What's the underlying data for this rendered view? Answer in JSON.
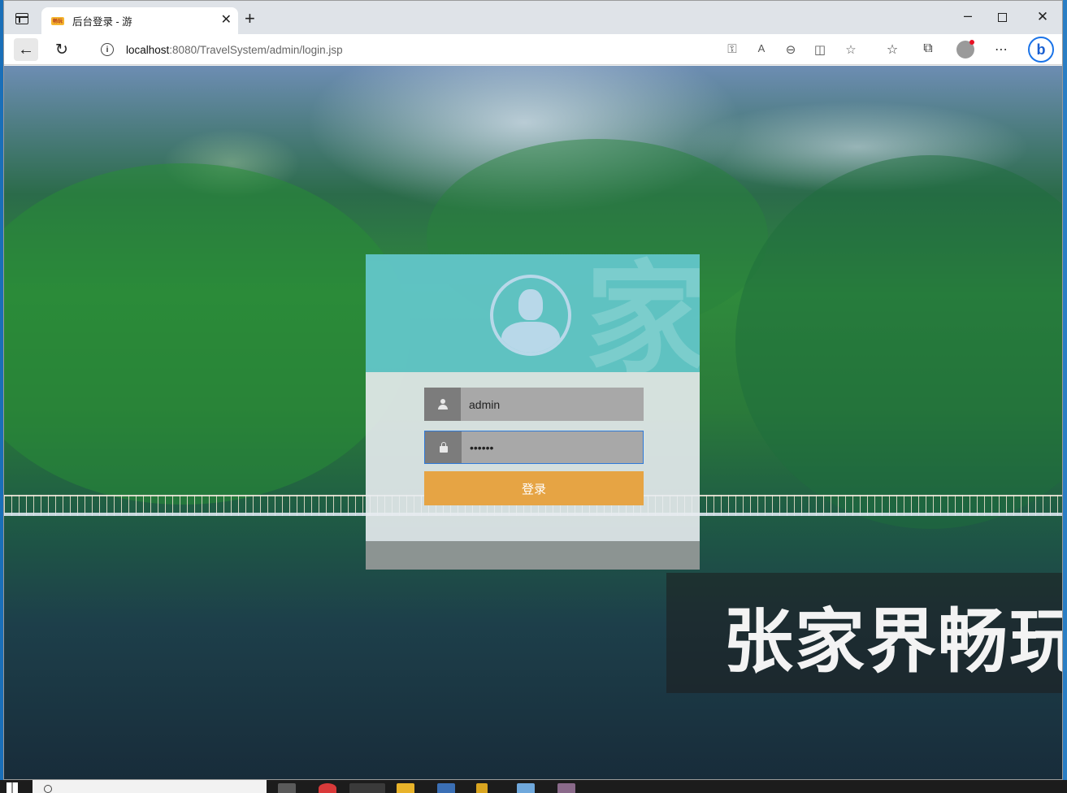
{
  "browser": {
    "tab_title": "后台登录 - 游",
    "tab_favicon_text": "畅玩",
    "url_host": "localhost",
    "url_path": ":8080/TravelSystem/admin/login.jsp"
  },
  "login": {
    "username_value": "admin",
    "password_value": "••••••",
    "submit_label": "登录",
    "header_glyph": "家"
  },
  "banner": {
    "text": "张家界畅玩"
  },
  "colors": {
    "header_teal": "#64c8cd",
    "button_orange": "#e6a444",
    "focus_blue": "#2f7ad8"
  }
}
